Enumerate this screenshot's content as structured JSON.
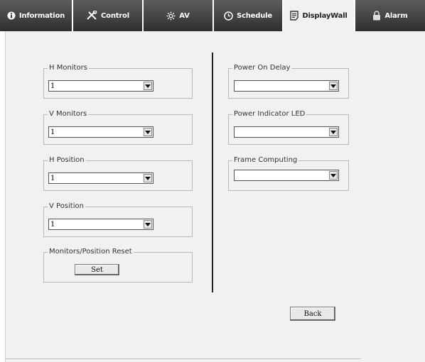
{
  "tabs": [
    {
      "label": "Information",
      "icon": "info-icon"
    },
    {
      "label": "Control",
      "icon": "tools-icon"
    },
    {
      "label": "AV",
      "icon": "av-icon"
    },
    {
      "label": "Schedule",
      "icon": "clock-icon"
    },
    {
      "label": "DisplayWall",
      "icon": "document-icon",
      "active": true
    },
    {
      "label": "Alarm",
      "icon": "lock-icon"
    }
  ],
  "left": {
    "h_monitors": {
      "legend": "H Monitors",
      "value": "1"
    },
    "v_monitors": {
      "legend": "V Monitors",
      "value": "1"
    },
    "h_position": {
      "legend": "H Position",
      "value": "1"
    },
    "v_position": {
      "legend": "V Position",
      "value": "1"
    },
    "reset": {
      "legend": "Monitors/Position Reset",
      "button": "Set"
    }
  },
  "right": {
    "power_on_delay": {
      "legend": "Power On Delay",
      "value": ""
    },
    "power_indicator_led": {
      "legend": "Power Indicator LED",
      "value": ""
    },
    "frame_computing": {
      "legend": "Frame Computing",
      "value": ""
    }
  },
  "footer": {
    "back_label": "Back"
  }
}
